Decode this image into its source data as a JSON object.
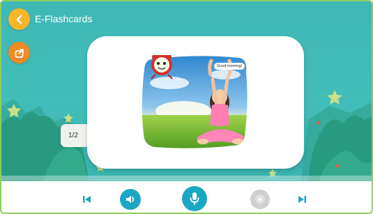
{
  "header": {
    "title": "E-Flashcards",
    "back_icon": "chevron-left-icon",
    "share_icon": "share-icon"
  },
  "card": {
    "page_indicator": "1/2",
    "speech_bubble": "Good morning!",
    "image": "girl-stretching-in-field",
    "clock_icon": "alarm-clock-icon"
  },
  "controls": {
    "prev_icon": "skip-previous-icon",
    "audio_icon": "speaker-icon",
    "mic_icon": "microphone-icon",
    "play_icon": "play-icon",
    "next_icon": "skip-next-icon"
  },
  "colors": {
    "background": "#3fb8b6",
    "back_button": "#f6b627",
    "share_button": "#f08a22",
    "control_accent": "#1ba7c3",
    "control_disabled": "#cfcfcf",
    "frame_border": "#8ecf58"
  }
}
